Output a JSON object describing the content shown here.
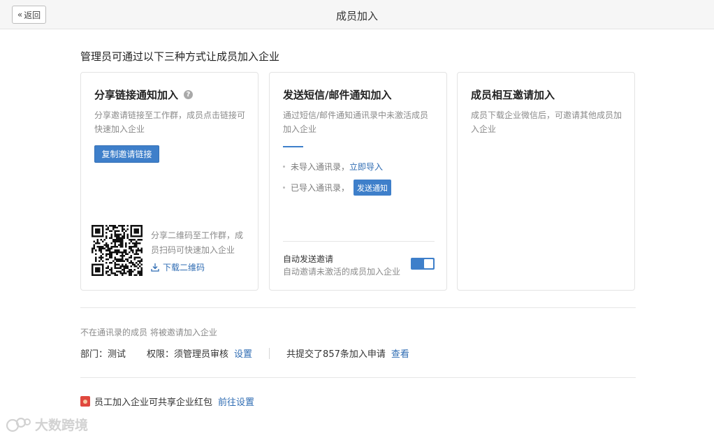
{
  "topbar": {
    "back_label": "返回",
    "title": "成员加入"
  },
  "intro": "管理员可通过以下三种方式让成员加入企业",
  "cards": {
    "share": {
      "title": "分享链接通知加入",
      "desc": "分享邀请链接至工作群，成员点击链接可快速加入企业",
      "button": "复制邀请链接",
      "qr_desc": "分享二维码至工作群，成员扫码可快速加入企业",
      "download": "下载二维码"
    },
    "sms": {
      "title": "发送短信/邮件通知加入",
      "desc": "通过短信/邮件通知通讯录中未激活成员加入企业",
      "not_imported": "未导入通讯录，",
      "import_now": "立即导入",
      "imported": "已导入通讯录，",
      "send_notice": "发送通知",
      "auto_title": "自动发送邀请",
      "auto_desc": "自动邀请未激活的成员加入企业",
      "auto_enabled": true
    },
    "mutual": {
      "title": "成员相互邀请加入",
      "desc": "成员下载企业微信后，可邀请其他成员加入企业"
    }
  },
  "footer": {
    "note": "不在通讯录的成员 将被邀请加入企业",
    "dept": "部门：测试",
    "perm": "权限：须管理员审核",
    "perm_link": "设置",
    "submitted": "共提交了857条加入申请",
    "view_link": "查看",
    "redpack_text": "员工加入企业可共享企业红包",
    "redpack_link": "前往设置"
  },
  "watermark": "大数跨境",
  "colors": {
    "accent": "#3e7fca",
    "link": "#2f6cb3"
  }
}
